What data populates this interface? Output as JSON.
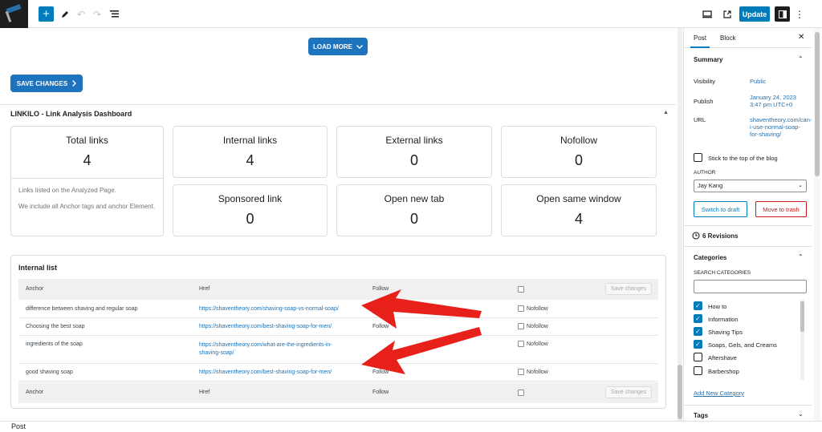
{
  "toolbar": {
    "update_label": "Update"
  },
  "main": {
    "load_more_label": "LOAD MORE",
    "save_changes_label": "SAVE CHANGES",
    "dashboard_title": "LINKILO - Link Analysis Dashboard",
    "stats": [
      {
        "label": "Total links",
        "value": "4"
      },
      {
        "label": "Internal links",
        "value": "4"
      },
      {
        "label": "External links",
        "value": "0"
      },
      {
        "label": "Nofollow",
        "value": "0"
      },
      {
        "label": "Sponsored link",
        "value": "0"
      },
      {
        "label": "Open new tab",
        "value": "0"
      },
      {
        "label": "Open same window",
        "value": "4"
      }
    ],
    "total_note_1": "Links listed on the Analyzed Page.",
    "total_note_2": "We include all Anchor tags and anchor Element.",
    "internal_list": {
      "title": "Internal list",
      "headers": {
        "anchor": "Anchor",
        "href": "Href",
        "follow": "Follow",
        "save": "Save changes"
      },
      "rows": [
        {
          "anchor": "difference between shaving and regular soap",
          "href": "https://shaventheory.com/shaving-soap-vs-normal-soap/",
          "follow": "",
          "nofollow": "Nofollow"
        },
        {
          "anchor": "Choosing the best soap",
          "href": "https://shaventheory.com/best-shaving-soap-for-men/",
          "follow": "Follow",
          "nofollow": "Nofollow"
        },
        {
          "anchor": "ingredients of the soap",
          "href": "https://shaventheory.com/what-are-the-ingredients-in-shaving-soap/",
          "follow": "",
          "nofollow": "Nofollow"
        },
        {
          "anchor": "good shaving soap",
          "href": "https://shaventheory.com/best-shaving-soap-for-men/",
          "follow": "Follow",
          "nofollow": "Nofollow"
        }
      ]
    }
  },
  "sidebar": {
    "tabs": {
      "post": "Post",
      "block": "Block"
    },
    "summary": {
      "title": "Summary",
      "visibility_key": "Visibility",
      "visibility_val": "Public",
      "publish_key": "Publish",
      "publish_val": "January 24, 2023 3:47 pm UTC+0",
      "url_key": "URL",
      "url_val": "shaventheory.com/can-i-use-normal-soap-for-shaving/",
      "sticky_label": "Stick to the top of the blog",
      "author_label": "AUTHOR",
      "author_value": "Jay Kang",
      "switch_draft": "Switch to draft",
      "move_trash": "Move to trash"
    },
    "revisions": "6 Revisions",
    "categories": {
      "title": "Categories",
      "search_label": "SEARCH CATEGORIES",
      "items": [
        {
          "label": "How to",
          "checked": true
        },
        {
          "label": "Information",
          "checked": true
        },
        {
          "label": "Shaving Tips",
          "checked": true
        },
        {
          "label": "Soaps, Gels, and Creams",
          "checked": true
        },
        {
          "label": "Aftershave",
          "checked": false
        },
        {
          "label": "Barbershop",
          "checked": false
        }
      ],
      "add_new": "Add New Category"
    },
    "tags_title": "Tags"
  },
  "footer": {
    "breadcrumb": "Post"
  },
  "colors": {
    "accent": "#007cba",
    "button_blue": "#1e73be",
    "annotation_red": "#e8201a",
    "danger": "#cc1818"
  }
}
